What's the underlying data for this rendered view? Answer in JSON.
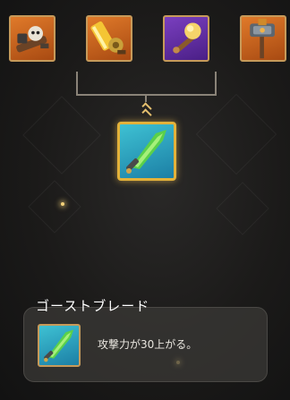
{
  "recipe": {
    "materials": [
      {
        "icon": "skull-cannon-icon"
      },
      {
        "icon": "golden-chainsaw-icon"
      },
      {
        "icon": "golden-torch-icon"
      },
      {
        "icon": "ornate-hammer-icon"
      }
    ],
    "result": {
      "icon": "ghost-blade-icon"
    }
  },
  "item": {
    "name": "ゴーストブレード",
    "icon": "ghost-blade-icon",
    "description": "攻撃力が30上がる。"
  },
  "colors": {
    "slot_border": "#c69a5a",
    "result_border": "#e3b23a",
    "slot_orange": "#e07a2a",
    "slot_purple": "#7a3fbf",
    "slot_teal": "#3ec1d3"
  }
}
